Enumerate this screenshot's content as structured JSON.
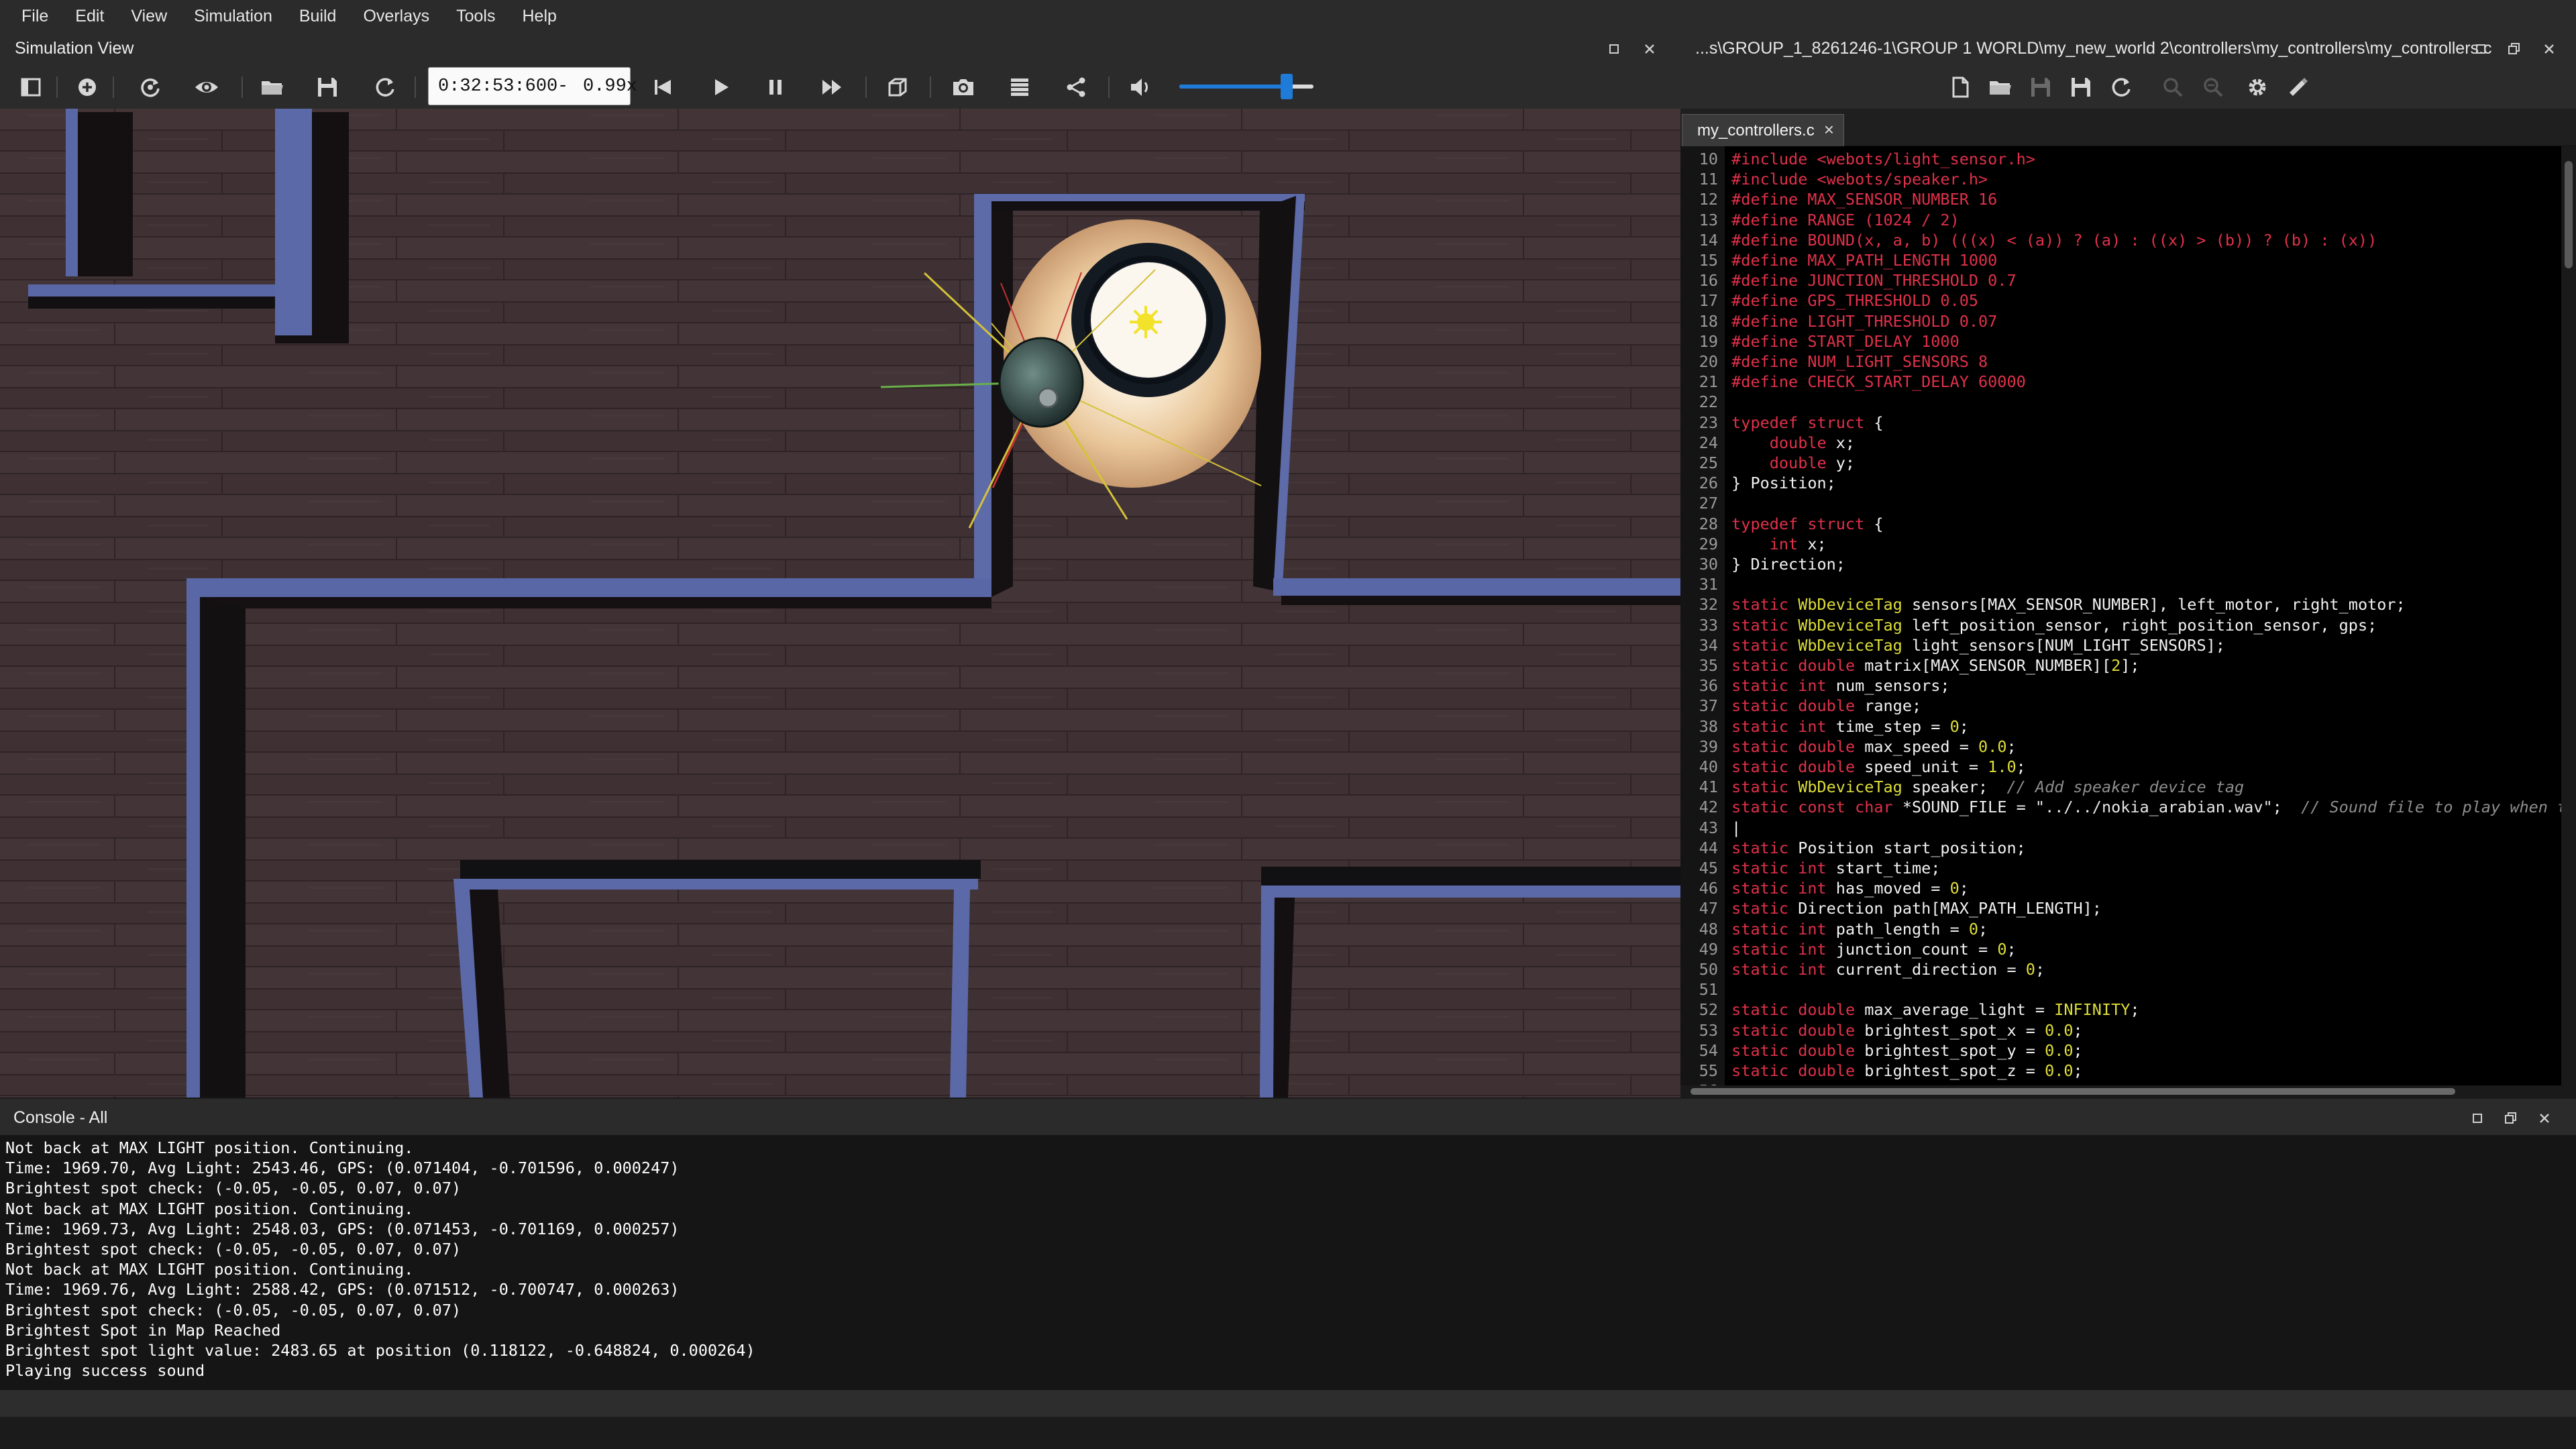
{
  "menubar": {
    "items": [
      "File",
      "Edit",
      "View",
      "Simulation",
      "Build",
      "Overlays",
      "Tools",
      "Help"
    ]
  },
  "simulation_view": {
    "title": "Simulation View",
    "time": "0:32:53:600",
    "time_separator": "-",
    "speed": "0.99x",
    "volume_level": 0.8,
    "accent_color": "#1e7bd8",
    "toolbar_icons": [
      "toggle-scene-tree-icon",
      "add-node-icon",
      "reload-icon",
      "eye-icon",
      "open-world-icon",
      "save-world-icon",
      "reset-icon",
      "step-back-icon",
      "play-icon",
      "pause-icon",
      "fast-forward-icon",
      "rendering-mode-icon",
      "screenshot-icon",
      "record-movie-icon",
      "share-icon",
      "volume-icon"
    ]
  },
  "editor": {
    "path": "...s\\GROUP_1_8261246-1\\GROUP 1 WORLD\\my_new_world 2\\controllers\\my_controllers\\my_controllers.c",
    "tab_label": "my_controllers.c",
    "toolbar_icons": [
      "new-file-icon",
      "open-file-icon",
      "save-file-icon",
      "save-as-icon",
      "revert-icon",
      "find-icon",
      "replace-icon",
      "settings-icon",
      "build-icon"
    ],
    "lines": [
      {
        "n": "10",
        "t": [
          [
            "pp",
            "#include <webots/light_sensor.h>"
          ]
        ]
      },
      {
        "n": "11",
        "t": [
          [
            "pp",
            "#include <webots/speaker.h>"
          ]
        ]
      },
      {
        "n": "12",
        "t": [
          [
            "pp",
            "#define MAX_SENSOR_NUMBER 16"
          ]
        ]
      },
      {
        "n": "13",
        "t": [
          [
            "pp",
            "#define RANGE (1024 / 2)"
          ]
        ]
      },
      {
        "n": "14",
        "t": [
          [
            "pp",
            "#define BOUND(x, a, b) (((x) < (a)) ? (a) : ((x) > (b)) ? (b) : (x))"
          ]
        ]
      },
      {
        "n": "15",
        "t": [
          [
            "pp",
            "#define MAX_PATH_LENGTH 1000"
          ]
        ]
      },
      {
        "n": "16",
        "t": [
          [
            "pp",
            "#define JUNCTION_THRESHOLD 0.7"
          ]
        ]
      },
      {
        "n": "17",
        "t": [
          [
            "pp",
            "#define GPS_THRESHOLD 0.05"
          ]
        ]
      },
      {
        "n": "18",
        "t": [
          [
            "pp",
            "#define LIGHT_THRESHOLD 0.07"
          ]
        ]
      },
      {
        "n": "19",
        "t": [
          [
            "pp",
            "#define START_DELAY 1000"
          ]
        ]
      },
      {
        "n": "20",
        "t": [
          [
            "pp",
            "#define NUM_LIGHT_SENSORS 8"
          ]
        ]
      },
      {
        "n": "21",
        "t": [
          [
            "pp",
            "#define CHECK_START_DELAY 60000"
          ]
        ]
      },
      {
        "n": "22",
        "t": []
      },
      {
        "n": "23",
        "t": [
          [
            "kw",
            "typedef struct"
          ],
          [
            "id",
            " {"
          ]
        ]
      },
      {
        "n": "24",
        "t": [
          [
            "id",
            "    "
          ],
          [
            "kw",
            "double"
          ],
          [
            "id",
            " x;"
          ]
        ]
      },
      {
        "n": "25",
        "t": [
          [
            "id",
            "    "
          ],
          [
            "kw",
            "double"
          ],
          [
            "id",
            " y;"
          ]
        ]
      },
      {
        "n": "26",
        "t": [
          [
            "id",
            "} Position;"
          ]
        ]
      },
      {
        "n": "27",
        "t": []
      },
      {
        "n": "28",
        "t": [
          [
            "kw",
            "typedef struct"
          ],
          [
            "id",
            " {"
          ]
        ]
      },
      {
        "n": "29",
        "t": [
          [
            "id",
            "    "
          ],
          [
            "kw",
            "int"
          ],
          [
            "id",
            " x;"
          ]
        ]
      },
      {
        "n": "30",
        "t": [
          [
            "id",
            "} Direction;"
          ]
        ]
      },
      {
        "n": "31",
        "t": []
      },
      {
        "n": "32",
        "t": [
          [
            "kw",
            "static"
          ],
          [
            "id",
            " "
          ],
          [
            "ty",
            "WbDeviceTag"
          ],
          [
            "id",
            " sensors[MAX_SENSOR_NUMBER], left_motor, right_motor;"
          ]
        ]
      },
      {
        "n": "33",
        "t": [
          [
            "kw",
            "static"
          ],
          [
            "id",
            " "
          ],
          [
            "ty",
            "WbDeviceTag"
          ],
          [
            "id",
            " left_position_sensor, right_position_sensor, gps;"
          ]
        ]
      },
      {
        "n": "34",
        "t": [
          [
            "kw",
            "static"
          ],
          [
            "id",
            " "
          ],
          [
            "ty",
            "WbDeviceTag"
          ],
          [
            "id",
            " light_sensors[NUM_LIGHT_SENSORS];"
          ]
        ]
      },
      {
        "n": "35",
        "t": [
          [
            "kw",
            "static"
          ],
          [
            "id",
            " "
          ],
          [
            "kw",
            "double"
          ],
          [
            "id",
            " matrix[MAX_SENSOR_NUMBER]["
          ],
          [
            "num",
            "2"
          ],
          [
            "id",
            "];"
          ]
        ]
      },
      {
        "n": "36",
        "t": [
          [
            "kw",
            "static"
          ],
          [
            "id",
            " "
          ],
          [
            "kw",
            "int"
          ],
          [
            "id",
            " num_sensors;"
          ]
        ]
      },
      {
        "n": "37",
        "t": [
          [
            "kw",
            "static"
          ],
          [
            "id",
            " "
          ],
          [
            "kw",
            "double"
          ],
          [
            "id",
            " range;"
          ]
        ]
      },
      {
        "n": "38",
        "t": [
          [
            "kw",
            "static"
          ],
          [
            "id",
            " "
          ],
          [
            "kw",
            "int"
          ],
          [
            "id",
            " time_step = "
          ],
          [
            "num",
            "0"
          ],
          [
            "id",
            ";"
          ]
        ]
      },
      {
        "n": "39",
        "t": [
          [
            "kw",
            "static"
          ],
          [
            "id",
            " "
          ],
          [
            "kw",
            "double"
          ],
          [
            "id",
            " max_speed = "
          ],
          [
            "num",
            "0.0"
          ],
          [
            "id",
            ";"
          ]
        ]
      },
      {
        "n": "40",
        "t": [
          [
            "kw",
            "static"
          ],
          [
            "id",
            " "
          ],
          [
            "kw",
            "double"
          ],
          [
            "id",
            " speed_unit = "
          ],
          [
            "num",
            "1.0"
          ],
          [
            "id",
            ";"
          ]
        ]
      },
      {
        "n": "41",
        "t": [
          [
            "kw",
            "static"
          ],
          [
            "id",
            " "
          ],
          [
            "ty",
            "WbDeviceTag"
          ],
          [
            "id",
            " speaker;  "
          ],
          [
            "cm",
            "// Add speaker device tag"
          ]
        ]
      },
      {
        "n": "42",
        "t": [
          [
            "kw",
            "static const char"
          ],
          [
            "id",
            " *SOUND_FILE = "
          ],
          [
            "str",
            "\"../../nokia_arabian.wav\""
          ],
          [
            "id",
            ";  "
          ],
          [
            "cm",
            "// Sound file to play when ta"
          ]
        ]
      },
      {
        "n": "43",
        "t": [
          [
            "id",
            "|"
          ]
        ]
      },
      {
        "n": "44",
        "t": [
          [
            "kw",
            "static"
          ],
          [
            "id",
            " Position start_position;"
          ]
        ]
      },
      {
        "n": "45",
        "t": [
          [
            "kw",
            "static"
          ],
          [
            "id",
            " "
          ],
          [
            "kw",
            "int"
          ],
          [
            "id",
            " start_time;"
          ]
        ]
      },
      {
        "n": "46",
        "t": [
          [
            "kw",
            "static"
          ],
          [
            "id",
            " "
          ],
          [
            "kw",
            "int"
          ],
          [
            "id",
            " has_moved = "
          ],
          [
            "num",
            "0"
          ],
          [
            "id",
            ";"
          ]
        ]
      },
      {
        "n": "47",
        "t": [
          [
            "kw",
            "static"
          ],
          [
            "id",
            " Direction path[MAX_PATH_LENGTH];"
          ]
        ]
      },
      {
        "n": "48",
        "t": [
          [
            "kw",
            "static"
          ],
          [
            "id",
            " "
          ],
          [
            "kw",
            "int"
          ],
          [
            "id",
            " path_length = "
          ],
          [
            "num",
            "0"
          ],
          [
            "id",
            ";"
          ]
        ]
      },
      {
        "n": "49",
        "t": [
          [
            "kw",
            "static"
          ],
          [
            "id",
            " "
          ],
          [
            "kw",
            "int"
          ],
          [
            "id",
            " junction_count = "
          ],
          [
            "num",
            "0"
          ],
          [
            "id",
            ";"
          ]
        ]
      },
      {
        "n": "50",
        "t": [
          [
            "kw",
            "static"
          ],
          [
            "id",
            " "
          ],
          [
            "kw",
            "int"
          ],
          [
            "id",
            " current_direction = "
          ],
          [
            "num",
            "0"
          ],
          [
            "id",
            ";"
          ]
        ]
      },
      {
        "n": "51",
        "t": []
      },
      {
        "n": "52",
        "t": [
          [
            "kw",
            "static"
          ],
          [
            "id",
            " "
          ],
          [
            "kw",
            "double"
          ],
          [
            "id",
            " max_average_light = "
          ],
          [
            "num",
            "INFINITY"
          ],
          [
            "id",
            ";"
          ]
        ]
      },
      {
        "n": "53",
        "t": [
          [
            "kw",
            "static"
          ],
          [
            "id",
            " "
          ],
          [
            "kw",
            "double"
          ],
          [
            "id",
            " brightest_spot_x = "
          ],
          [
            "num",
            "0.0"
          ],
          [
            "id",
            ";"
          ]
        ]
      },
      {
        "n": "54",
        "t": [
          [
            "kw",
            "static"
          ],
          [
            "id",
            " "
          ],
          [
            "kw",
            "double"
          ],
          [
            "id",
            " brightest_spot_y = "
          ],
          [
            "num",
            "0.0"
          ],
          [
            "id",
            ";"
          ]
        ]
      },
      {
        "n": "55",
        "t": [
          [
            "kw",
            "static"
          ],
          [
            "id",
            " "
          ],
          [
            "kw",
            "double"
          ],
          [
            "id",
            " brightest_spot_z = "
          ],
          [
            "num",
            "0.0"
          ],
          [
            "id",
            ";"
          ]
        ]
      },
      {
        "n": "56",
        "t": []
      }
    ]
  },
  "console": {
    "title": "Console - All",
    "lines": [
      "Not back at MAX LIGHT position. Continuing.",
      "Time: 1969.70, Avg Light: 2543.46, GPS: (0.071404, -0.701596, 0.000247)",
      "Brightest spot check: (-0.05, -0.05, 0.07, 0.07)",
      "Not back at MAX LIGHT position. Continuing.",
      "Time: 1969.73, Avg Light: 2548.03, GPS: (0.071453, -0.701169, 0.000257)",
      "Brightest spot check: (-0.05, -0.05, 0.07, 0.07)",
      "Not back at MAX LIGHT position. Continuing.",
      "Time: 1969.76, Avg Light: 2588.42, GPS: (0.071512, -0.700747, 0.000263)",
      "Brightest spot check: (-0.05, -0.05, 0.07, 0.07)",
      "Brightest Spot in Map Reached",
      "Brightest spot light value: 2483.65 at position (0.118122, -0.648824, 0.000264)",
      "Playing success sound"
    ]
  }
}
